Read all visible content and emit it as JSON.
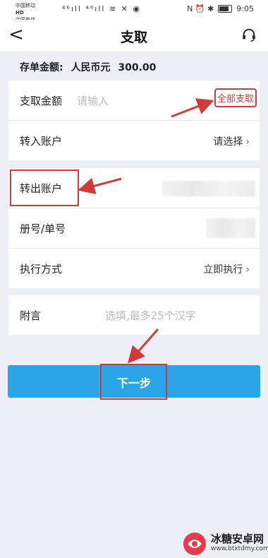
{
  "status_bar": {
    "carrier1": "中国移动",
    "carrier2": "中国电信",
    "net_tag": "HD",
    "icons_text": "⁴⁶ıll ⁴⁶ıll ≋ ✕ ◉",
    "right_icons": "N ⏰ ✱",
    "time": "9:05"
  },
  "nav": {
    "back": "<",
    "title": "支取",
    "service_icon": "headset-icon"
  },
  "balance": {
    "label": "存单金额:",
    "currency": "人民币元",
    "amount": "300.00"
  },
  "form": {
    "amount_label": "支取金额",
    "amount_placeholder": "请输入",
    "withdraw_all": "全部支取",
    "to_account_label": "转入账户",
    "to_account_value": "请选择",
    "from_account_label": "转出账户",
    "book_label": "册号/单号",
    "exec_label": "执行方式",
    "exec_value": "立即执行",
    "memo_label": "附言",
    "memo_placeholder": "选填,最多25个汉字"
  },
  "next_button": "下一步",
  "watermark": {
    "title": "冰糖安卓网",
    "url": "www.btxtdmy.com"
  },
  "colors": {
    "accent": "#2aa5e7",
    "annotation_red": "#d23a3a",
    "background": "#eeeef6"
  }
}
